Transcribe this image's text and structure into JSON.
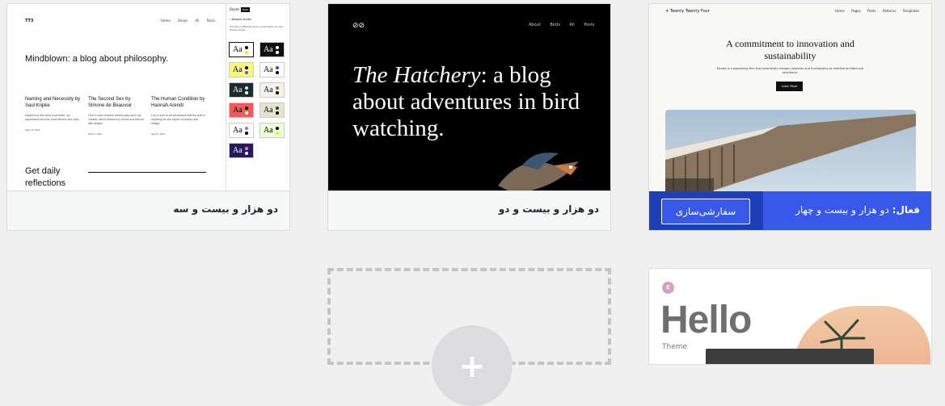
{
  "themes": [
    {
      "caption": "دو هزار و بیست و سه",
      "preview": {
        "logo": "TT3",
        "nav": "Home  Books  All Posts",
        "hero": "Mindblown: a blog about philosophy.",
        "posts": [
          {
            "title": "Naming and Necessity by Saul Kripke",
            "excerpt": "Inspired by this wind of promise, my daydreams become more fervent and vivid.",
            "date": "Sept 15, 2021"
          },
          {
            "title": "The Second Sex by Simone de Beauvoir",
            "excerpt": "I feel a cold northern breeze play upon my cheeks, which braces my nerves and fills me with delight.",
            "date": "Sept 5, 2021"
          },
          {
            "title": "The Human Condition by Hannah Arendt",
            "excerpt": "I try in vain to be persuaded that the pole is anything but the region of beauty and delight.",
            "date": "Sept 5, 2021"
          }
        ],
        "daily": "Get daily reflections",
        "panel": {
          "header": "Styles",
          "tag": "Beta",
          "subtitle": "Browse styles",
          "desc": "Choose a different style combination for the theme styles",
          "swatch_label": "Aa",
          "swatches": [
            {
              "bg": "#ffffff",
              "fg": "#000000",
              "dot1": "#000000",
              "dot2": "#ffe900"
            },
            {
              "bg": "#111111",
              "fg": "#ffffff",
              "dot1": "#ffffff",
              "dot2": "#ffffff"
            },
            {
              "bg": "#f6f681",
              "fg": "#000000",
              "dot1": "#000000",
              "dot2": "#5b4cff"
            },
            {
              "bg": "#ffffff",
              "fg": "#000000",
              "dot1": "#1c4fff",
              "dot2": "#000000"
            },
            {
              "bg": "#1c2c2e",
              "fg": "#ffffff",
              "dot1": "#c0f0ff",
              "dot2": "#ffffff"
            },
            {
              "bg": "#f4f2ec",
              "fg": "#000000",
              "dot1": "#a95a30",
              "dot2": "#000000"
            },
            {
              "bg": "#f25a5a",
              "fg": "#000000",
              "dot1": "#000000",
              "dot2": "#ffffff"
            },
            {
              "bg": "#e4e2d0",
              "fg": "#000000",
              "dot1": "#2e4020",
              "dot2": "#000000"
            },
            {
              "bg": "#ffffff",
              "fg": "#000000",
              "dot1": "#7c7cff",
              "dot2": "#000000"
            },
            {
              "bg": "#eaffd8",
              "fg": "#000000",
              "dot1": "#000000",
              "dot2": "#ffe900"
            },
            {
              "bg": "#241c5a",
              "fg": "#ffffff",
              "dot1": "#ff6cc5",
              "dot2": "#ffffff"
            }
          ]
        }
      }
    },
    {
      "caption": "دو هزار و بیست و دو",
      "preview": {
        "logo": "⊘⊘",
        "nav": "About  Birds  All Posts",
        "hero_italic": "The Hatchery",
        "hero_rest": ": a blog about adventures in bird watching."
      }
    },
    {
      "caption_prefix": "فعال:",
      "caption": "دو هزار و بیست و چهار",
      "customize_label": "سفارشی‌سازی",
      "preview": {
        "logo": "Twenty Twenty Four",
        "nav": "Home Pages Posts Patterns Templates",
        "hero": "A commitment to innovation and sustainability",
        "sub": "Études is a pioneering firm that seamlessly merges creativity and functionality to redefine architectural excellence.",
        "button": "Learn More"
      }
    },
    {
      "caption": "",
      "preview": {
        "logo": "E",
        "hello": "Hello",
        "theme": "Theme"
      }
    }
  ],
  "add_new": {
    "icon": "plus-icon",
    "symbol": "+"
  },
  "colors": {
    "accent": "#3858e9",
    "bg": "#f0f0f1"
  }
}
